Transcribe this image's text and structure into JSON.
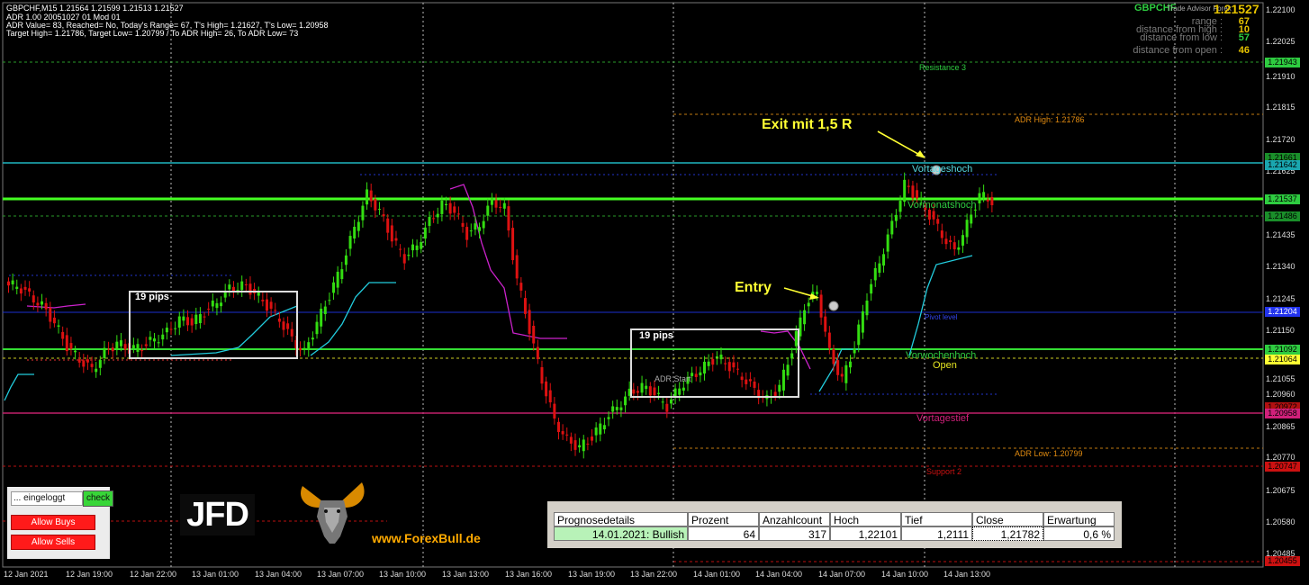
{
  "header": {
    "line1": "GBPCHF,M15  1.21564 1.21599 1.21513 1.21527",
    "line2": "ADR 1.00 20051027 01 Mod 01",
    "line3": "ADR Value= 83, Reached= No, Today's Range= 67, T's High= 1.21627, T's Low= 1.20958",
    "line4": "Target High= 1.21786, Target Low= 1.20799 / To ADR High= 26, To ADR Low= 73"
  },
  "info_panel": {
    "symbol": "GBPCHF",
    "subtitle": "Trade Advisor Forex",
    "price": "1.21527",
    "rows": [
      {
        "label": "range :",
        "value": "67",
        "color": "#e6c300"
      },
      {
        "label": "distance from high :",
        "value": "10",
        "color": "#e6c300"
      },
      {
        "label": "distance from low :",
        "value": "57",
        "color": "#2ecc40"
      },
      {
        "label": "distance from open :",
        "value": "46",
        "color": "#e6c300"
      }
    ]
  },
  "annotations": {
    "exit": "Exit mit 1,5 R",
    "entry": "Entry"
  },
  "levels": {
    "resistance3": "Resistance 3",
    "adr_high": "ADR High: 1.21786",
    "vortageshoch": "Vortageshoch",
    "vormonatshoch": "Vormonatshoch",
    "pivot": "Pivot level",
    "vorwochenhoch": "Vorwochenhoch",
    "open": "Open",
    "vortagestief": "Vortagestief",
    "adr_low": "ADR Low: 1.20799",
    "support2": "Support 2"
  },
  "box_labels": {
    "pips1": "19 pips",
    "pips2": "19 pips",
    "adr_start": "ADR Start"
  },
  "price_axis": [
    "1.22100",
    "1.22025",
    "1.21910",
    "1.21815",
    "1.21720",
    "1.21625",
    "1.21530",
    "1.21435",
    "1.21340",
    "1.21245",
    "1.21150",
    "1.21055",
    "1.20960",
    "1.20865",
    "1.20770",
    "1.20675",
    "1.20580",
    "1.20485"
  ],
  "price_tags": [
    {
      "text": "1.21943",
      "bg": "#2ecc40"
    },
    {
      "text": "1.21661",
      "bg": "#1a8f2a"
    },
    {
      "text": "1.21642",
      "bg": "#1aa6b0"
    },
    {
      "text": "1.21537",
      "bg": "#2ecc40"
    },
    {
      "text": "1.21486",
      "bg": "#1a8f2a"
    },
    {
      "text": "1.21204",
      "bg": "#2233ee"
    },
    {
      "text": "1.21092",
      "bg": "#2ecc40"
    },
    {
      "text": "1.21064",
      "bg": "#ffff33"
    },
    {
      "text": "1.20972",
      "bg": "#b01010"
    },
    {
      "text": "1.20958",
      "bg": "#d0207a"
    },
    {
      "text": "1.20747",
      "bg": "#cc1111"
    },
    {
      "text": "1.20455",
      "bg": "#cc1111"
    }
  ],
  "time_axis": [
    "12 Jan 2021",
    "12 Jan 19:00",
    "12 Jan 22:00",
    "13 Jan 01:00",
    "13 Jan 04:00",
    "13 Jan 07:00",
    "13 Jan 10:00",
    "13 Jan 13:00",
    "13 Jan 16:00",
    "13 Jan 19:00",
    "13 Jan 22:00",
    "14 Jan 01:00",
    "14 Jan 04:00",
    "14 Jan 07:00",
    "14 Jan 10:00",
    "14 Jan 13:00"
  ],
  "control_panel": {
    "status": "... eingeloggt",
    "check": "check",
    "allow_buys": "Allow Buys",
    "allow_sells": "Allow Sells"
  },
  "logos": {
    "jfd": "JFD",
    "website": "www.ForexBull.de"
  },
  "forecast_table": {
    "headers": [
      "Prognosedetails",
      "Prozent",
      "Anzahlcount",
      "Hoch",
      "Tief",
      "Close",
      "Erwartung"
    ],
    "row": [
      "14.01.2021: Bullish",
      "64",
      "317",
      "1,22101",
      "1,2111",
      "1,21782",
      "0,6 %"
    ]
  },
  "chart_data": {
    "type": "candlestick",
    "symbol": "GBPCHF",
    "timeframe": "M15",
    "ohlc_current": {
      "open": 1.21564,
      "high": 1.21599,
      "low": 1.21513,
      "close": 1.21527
    },
    "approx_close_path": [
      1.2128,
      1.2125,
      1.2122,
      1.2117,
      1.211,
      1.2106,
      1.2103,
      1.2108,
      1.2111,
      1.2109,
      1.211,
      1.2112,
      1.2114,
      1.2118,
      1.2117,
      1.212,
      1.2123,
      1.2127,
      1.2128,
      1.2126,
      1.2122,
      1.2118,
      1.2112,
      1.2108,
      1.2117,
      1.2125,
      1.2134,
      1.2145,
      1.2155,
      1.215,
      1.2142,
      1.2136,
      1.214,
      1.2147,
      1.2152,
      1.215,
      1.2143,
      1.2146,
      1.2153,
      1.2151,
      1.213,
      1.2115,
      1.21,
      1.2088,
      1.2082,
      1.208,
      1.2083,
      1.2088,
      1.2092,
      1.2096,
      1.2098,
      1.2096,
      1.2092,
      1.2098,
      1.2101,
      1.2104,
      1.2107,
      1.2104,
      1.2101,
      1.2097,
      1.2094,
      1.2098,
      1.2109,
      1.2122,
      1.2126,
      1.2108,
      1.21,
      1.211,
      1.2125,
      1.2135,
      1.2146,
      1.2158,
      1.2154,
      1.2149,
      1.2143,
      1.2138,
      1.2146,
      1.2155,
      1.2153
    ]
  }
}
